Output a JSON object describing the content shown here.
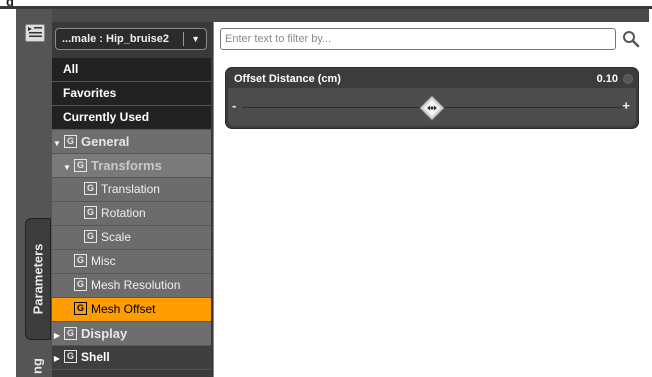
{
  "window": {
    "title": "g"
  },
  "toolbar": {
    "menu_icon": "pane-options-icon"
  },
  "side_tabs": {
    "parameters": "Parameters",
    "next_partial": "ng"
  },
  "node_selector": {
    "value": "...male : Hip_bruise2",
    "arrow": "▼"
  },
  "filter": {
    "placeholder": "Enter text to filter by...",
    "value": ""
  },
  "tree": {
    "all": "All",
    "favorites": "Favorites",
    "currently_used": "Currently Used",
    "general": {
      "label": "General",
      "expanded": true
    },
    "transforms": {
      "label": "Transforms",
      "expanded": true
    },
    "translation": "Translation",
    "rotation": "Rotation",
    "scale": "Scale",
    "misc": "Misc",
    "mesh_resolution": "Mesh Resolution",
    "mesh_offset": {
      "label": "Mesh Offset",
      "selected": true
    },
    "display": {
      "label": "Display",
      "expanded": false
    },
    "shell": {
      "label": "Shell",
      "expanded": false
    },
    "group_icon_letter": "G",
    "expanded_glyph": "▼",
    "collapsed_glyph": "▶"
  },
  "slider": {
    "label": "Offset Distance (cm)",
    "value": "0.10",
    "position_fraction": 0.5,
    "minus": "-",
    "plus": "+"
  },
  "colors": {
    "selected": "#ff9c00",
    "panel_dark": "#3a3a3a",
    "tree_item": "#6c6c6c"
  }
}
